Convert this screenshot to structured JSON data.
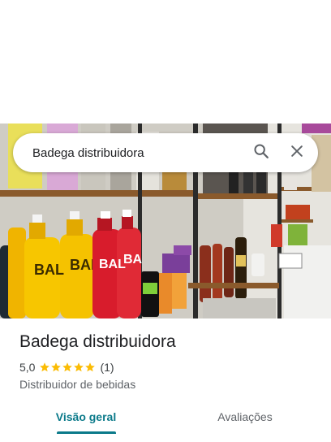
{
  "search": {
    "query": "Badega distribuidora",
    "search_icon": "search-icon",
    "clear_icon": "close-icon"
  },
  "place": {
    "name": "Badega distribuidora",
    "rating": "5,0",
    "stars": 5,
    "review_count": "(1)",
    "category": "Distribuidor de bebidas"
  },
  "tabs": [
    {
      "label": "Visão geral",
      "active": true
    },
    {
      "label": "Avaliações",
      "active": false
    }
  ],
  "colors": {
    "accent": "#0b7a8a",
    "star": "#fbbc04"
  }
}
